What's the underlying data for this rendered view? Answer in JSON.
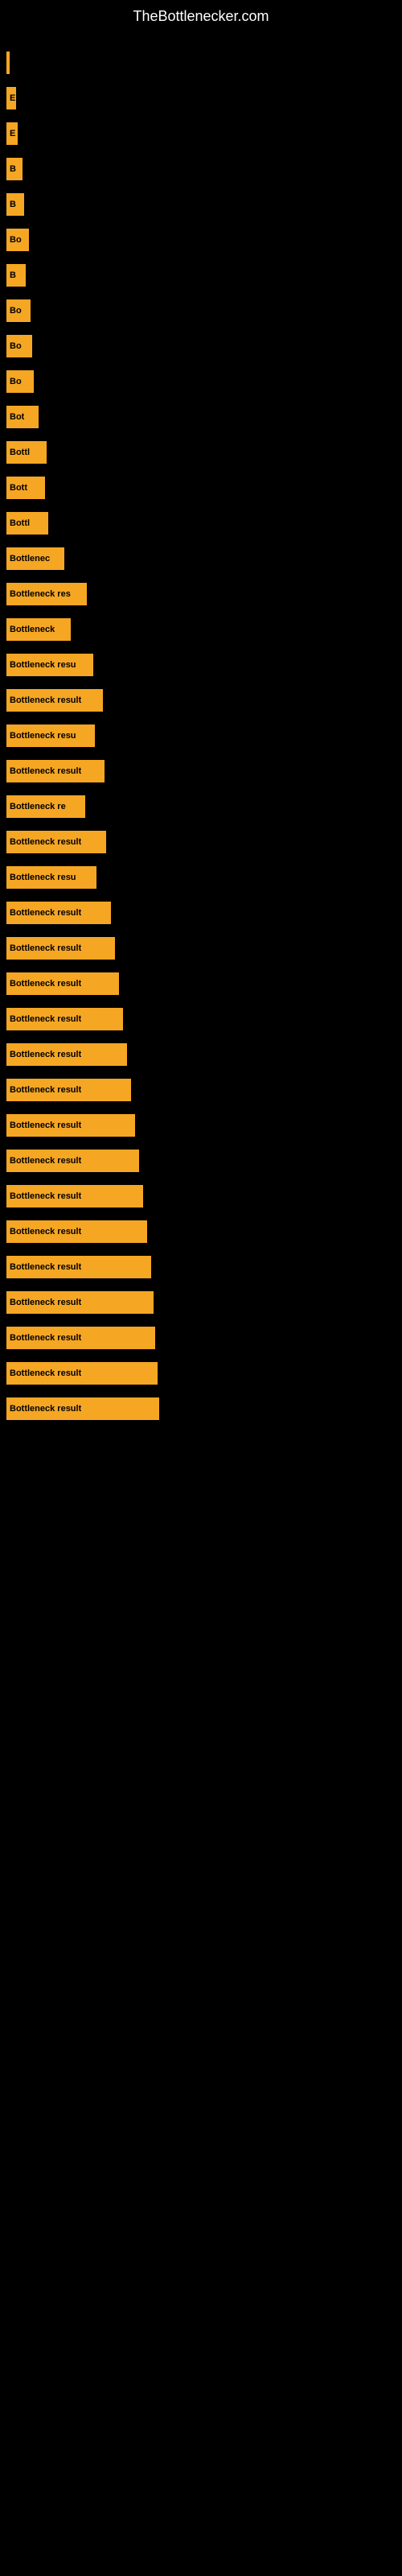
{
  "site": {
    "title": "TheBottlenecker.com"
  },
  "bars": [
    {
      "label": "",
      "width": 4
    },
    {
      "label": "E",
      "width": 12
    },
    {
      "label": "E",
      "width": 14
    },
    {
      "label": "B",
      "width": 20
    },
    {
      "label": "B",
      "width": 22
    },
    {
      "label": "Bo",
      "width": 28
    },
    {
      "label": "B",
      "width": 24
    },
    {
      "label": "Bo",
      "width": 30
    },
    {
      "label": "Bo",
      "width": 32
    },
    {
      "label": "Bo",
      "width": 34
    },
    {
      "label": "Bot",
      "width": 40
    },
    {
      "label": "Bottl",
      "width": 50
    },
    {
      "label": "Bott",
      "width": 48
    },
    {
      "label": "Bottl",
      "width": 52
    },
    {
      "label": "Bottlenec",
      "width": 72
    },
    {
      "label": "Bottleneck res",
      "width": 100
    },
    {
      "label": "Bottleneck",
      "width": 80
    },
    {
      "label": "Bottleneck resu",
      "width": 108
    },
    {
      "label": "Bottleneck result",
      "width": 120
    },
    {
      "label": "Bottleneck resu",
      "width": 110
    },
    {
      "label": "Bottleneck result",
      "width": 122
    },
    {
      "label": "Bottleneck re",
      "width": 98
    },
    {
      "label": "Bottleneck result",
      "width": 124
    },
    {
      "label": "Bottleneck resu",
      "width": 112
    },
    {
      "label": "Bottleneck result",
      "width": 130
    },
    {
      "label": "Bottleneck result",
      "width": 135
    },
    {
      "label": "Bottleneck result",
      "width": 140
    },
    {
      "label": "Bottleneck result",
      "width": 145
    },
    {
      "label": "Bottleneck result",
      "width": 150
    },
    {
      "label": "Bottleneck result",
      "width": 155
    },
    {
      "label": "Bottleneck result",
      "width": 160
    },
    {
      "label": "Bottleneck result",
      "width": 165
    },
    {
      "label": "Bottleneck result",
      "width": 170
    },
    {
      "label": "Bottleneck result",
      "width": 175
    },
    {
      "label": "Bottleneck result",
      "width": 180
    },
    {
      "label": "Bottleneck result",
      "width": 183
    },
    {
      "label": "Bottleneck result",
      "width": 185
    },
    {
      "label": "Bottleneck result",
      "width": 188
    },
    {
      "label": "Bottleneck result",
      "width": 190
    }
  ]
}
